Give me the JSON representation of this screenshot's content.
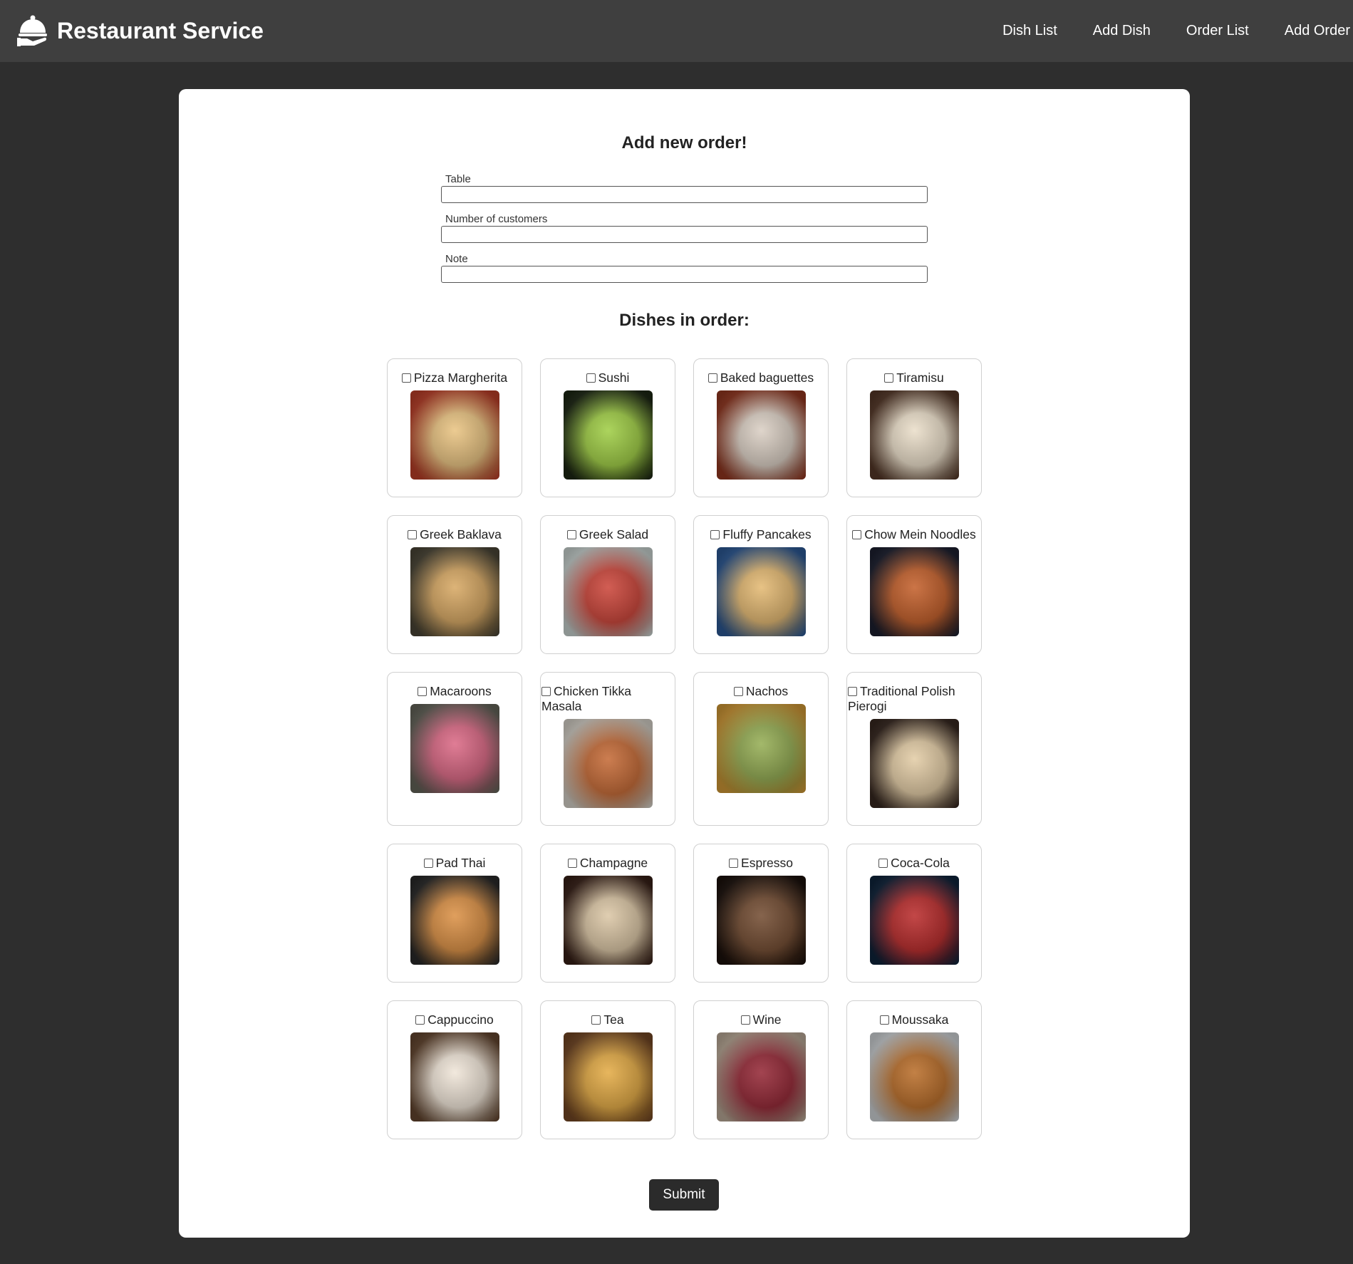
{
  "navbar": {
    "brand": "Restaurant Service",
    "links": [
      {
        "label": "Dish List"
      },
      {
        "label": "Add Dish"
      },
      {
        "label": "Order List"
      },
      {
        "label": "Add Order"
      }
    ]
  },
  "form": {
    "title": "Add new order!",
    "fields": {
      "table": {
        "label": "Table",
        "value": ""
      },
      "customers": {
        "label": "Number of customers",
        "value": ""
      },
      "note": {
        "label": "Note",
        "value": ""
      }
    },
    "dishes_title": "Dishes in order:",
    "submit_label": "Submit"
  },
  "dishes": [
    {
      "name": "Pizza Margherita",
      "checked": false,
      "photo": [
        "#c8432b",
        "#e8c07a"
      ]
    },
    {
      "name": "Sushi",
      "checked": false,
      "photo": [
        "#1f2a16",
        "#9acb3a"
      ]
    },
    {
      "name": "Baked baguettes",
      "checked": false,
      "photo": [
        "#9c3a22",
        "#d8ccc0"
      ]
    },
    {
      "name": "Tiramisu",
      "checked": false,
      "photo": [
        "#5a3b2a",
        "#e9dcc6"
      ]
    },
    {
      "name": "Greek Baklava",
      "checked": false,
      "photo": [
        "#4f4a3a",
        "#d5a35a"
      ]
    },
    {
      "name": "Greek Salad",
      "checked": false,
      "photo": [
        "#d9e3e0",
        "#c83a2e"
      ]
    },
    {
      "name": "Fluffy Pancakes",
      "checked": false,
      "photo": [
        "#2f5f9f",
        "#e2b56a"
      ]
    },
    {
      "name": "Chow Mein Noodles",
      "checked": false,
      "photo": [
        "#1e2233",
        "#c0561e"
      ]
    },
    {
      "name": "Macaroons",
      "checked": false,
      "photo": [
        "#6b6b60",
        "#d9607e"
      ]
    },
    {
      "name": "Chicken Tikka Masala",
      "checked": false,
      "photo": [
        "#e7e2d8",
        "#c1612a"
      ]
    },
    {
      "name": "Nachos",
      "checked": false,
      "photo": [
        "#e0a43a",
        "#8fa94a"
      ]
    },
    {
      "name": "Traditional Polish Pierogi",
      "checked": false,
      "photo": [
        "#3a2a22",
        "#e1c9a0"
      ]
    },
    {
      "name": "Pad Thai",
      "checked": false,
      "photo": [
        "#2d2d2d",
        "#d98a3a"
      ]
    },
    {
      "name": "Champagne",
      "checked": false,
      "photo": [
        "#3b2219",
        "#d9c3a0"
      ]
    },
    {
      "name": "Espresso",
      "checked": false,
      "photo": [
        "#1d120d",
        "#6b4226"
      ]
    },
    {
      "name": "Coca-Cola",
      "checked": false,
      "photo": [
        "#10263f",
        "#b51f1f"
      ]
    },
    {
      "name": "Cappuccino",
      "checked": false,
      "photo": [
        "#6a4a32",
        "#efe4d6"
      ]
    },
    {
      "name": "Tea",
      "checked": false,
      "photo": [
        "#7a4b26",
        "#e2a63a"
      ]
    },
    {
      "name": "Wine",
      "checked": false,
      "photo": [
        "#c8b6a2",
        "#8e1b2a"
      ]
    },
    {
      "name": "Moussaka",
      "checked": false,
      "photo": [
        "#dfe3e6",
        "#b5651d"
      ]
    }
  ],
  "colors": {
    "navbar_bg": "#3f3f3f",
    "page_bg": "#2e2e2e",
    "card_bg": "#ffffff",
    "button_bg": "#2b2b2b"
  }
}
